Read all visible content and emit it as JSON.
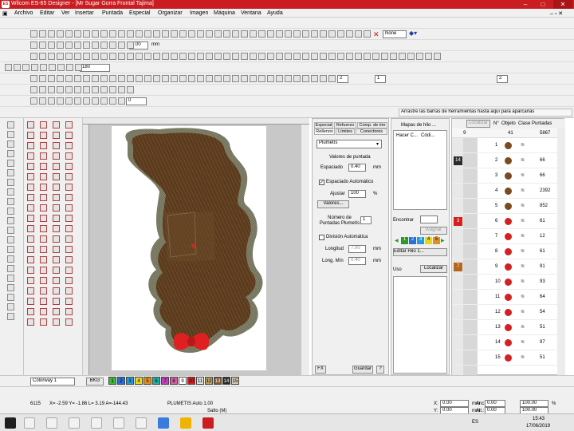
{
  "window": {
    "title": "Wilcom ES-65 Designer - [Mr Sugar Gorra Frontal        Tajima]"
  },
  "menu": [
    "Archivo",
    "Editar",
    "Ver",
    "Insertar",
    "Puntada",
    "Especial",
    "Organizar",
    "Imagen",
    "Máquina",
    "Ventana",
    "Ayuda"
  ],
  "toolbar": {
    "none_label": "None",
    "stitch_len": "0.00",
    "unit_mm": "mm",
    "zoom_angle": "180",
    "counter_a": "2",
    "counter_b": "1",
    "counter_c": "2",
    "counter_d": "0",
    "hint": "Arrastre las barras de herramientas hasta aquí para aparcarlas"
  },
  "object_props": {
    "tabs_top": [
      "Especial",
      "Refuerzo",
      "Comp. de tire"
    ],
    "tabs_bottom": [
      "Rellenos",
      "Límites",
      "Conectores"
    ],
    "fill_type": "Plumetís",
    "section_title": "Valores de puntada",
    "spacing_label": "Espaciado",
    "spacing_value": "0.40",
    "auto_spacing_label": "Espaciado Automático",
    "adjust_label": "Ajustar",
    "adjust_value": "100",
    "adjust_unit": "%",
    "values_button": "Valores...",
    "plumetis_count_label": "Número de Puntadas Plumetís",
    "plumetis_count_value": "1",
    "division_label": "División Automática",
    "length_label": "Longitud",
    "length_value": "7.00",
    "min_length_label": "Long. Mín",
    "min_length_value": "0.40",
    "unit": "mm",
    "fx_button": "FX",
    "save_button": "Guardar",
    "help_button": "?"
  },
  "thread_panel": {
    "title": "Mapas de hilo ...",
    "col_a": "Hacer C...",
    "col_b": "Códi...",
    "find_label": "Encontrar",
    "assign_button": "Asignar",
    "edit_thread_button": "Editar Hilo 1...",
    "use_label": "Uso",
    "locate_button": "Localizar",
    "color_numbers": [
      "1",
      "2",
      "3",
      "4",
      "5"
    ]
  },
  "sequence": {
    "locate_button": "Localizar",
    "headers": [
      "N°",
      "Objeto",
      "Clase",
      "Puntadas"
    ],
    "top_row": {
      "n": "9",
      "count": "41",
      "total": "5867"
    },
    "rows": [
      {
        "n": "1",
        "stitches": ""
      },
      {
        "n": "2",
        "stitches": "66"
      },
      {
        "n": "3",
        "stitches": "66"
      },
      {
        "n": "4",
        "stitches": "2392"
      },
      {
        "n": "5",
        "stitches": "852"
      },
      {
        "n": "6",
        "stitches": "61"
      },
      {
        "n": "7",
        "stitches": "12"
      },
      {
        "n": "8",
        "stitches": "61"
      },
      {
        "n": "9",
        "stitches": "91"
      },
      {
        "n": "10",
        "stitches": "93"
      },
      {
        "n": "11",
        "stitches": "64"
      },
      {
        "n": "12",
        "stitches": "54"
      },
      {
        "n": "13",
        "stitches": "51"
      },
      {
        "n": "14",
        "stitches": "97"
      },
      {
        "n": "15",
        "stitches": "51"
      }
    ],
    "color_badges": [
      {
        "row": 2,
        "label": "14",
        "color": "#2b2b2b"
      },
      {
        "row": 6,
        "label": "3",
        "color": "#d42020"
      },
      {
        "row": 9,
        "label": "7",
        "color": "#b5651d"
      }
    ]
  },
  "colorway": {
    "label": "Colorway 1",
    "bkg": "BKG",
    "swatches": [
      {
        "n": "1",
        "color": "#3cb83c"
      },
      {
        "n": "2",
        "color": "#2a6fd6"
      },
      {
        "n": "3",
        "color": "#2a9ad6"
      },
      {
        "n": "4",
        "color": "#e6d620"
      },
      {
        "n": "5",
        "color": "#e09020"
      },
      {
        "n": "6",
        "color": "#1fb0a0"
      },
      {
        "n": "7",
        "color": "#c040c0"
      },
      {
        "n": "8",
        "color": "#d060a0"
      },
      {
        "n": "9",
        "color": "#ffffff"
      },
      {
        "n": "10",
        "color": "#d02020"
      },
      {
        "n": "11",
        "color": "#e0e0e0"
      },
      {
        "n": "12",
        "color": "#b8a060"
      },
      {
        "n": "13",
        "color": "#7a5a30"
      },
      {
        "n": "14",
        "color": "#2a2a2a"
      },
      {
        "n": "15",
        "color": "#d0c8b0"
      }
    ]
  },
  "status": {
    "stitches": "6115",
    "coords": "X= -2.59 Y= -1.86 L= 3.19 A=-144.43",
    "fill_info": "PLUMETIS Auto  1.00",
    "jump": "Salto (M)",
    "x_label": "X:",
    "x_value": "0.00",
    "y_label": "Y:",
    "y_value": "0.00",
    "unit": "mm",
    "w_label": "Anc.:",
    "w_value": "0.00",
    "h_label": "Alt.:",
    "h_value": "0.00",
    "pct": "100.00",
    "pct_unit": "%"
  },
  "taskbar": {
    "lang": "ES",
    "time": "15:43",
    "date": "17/06/2019"
  },
  "colors": {
    "title_red": "#c91d21",
    "embroidery_brown": "#5a3b1e",
    "outline_gray": "#6e6e5a",
    "bow_red": "#e02020"
  }
}
